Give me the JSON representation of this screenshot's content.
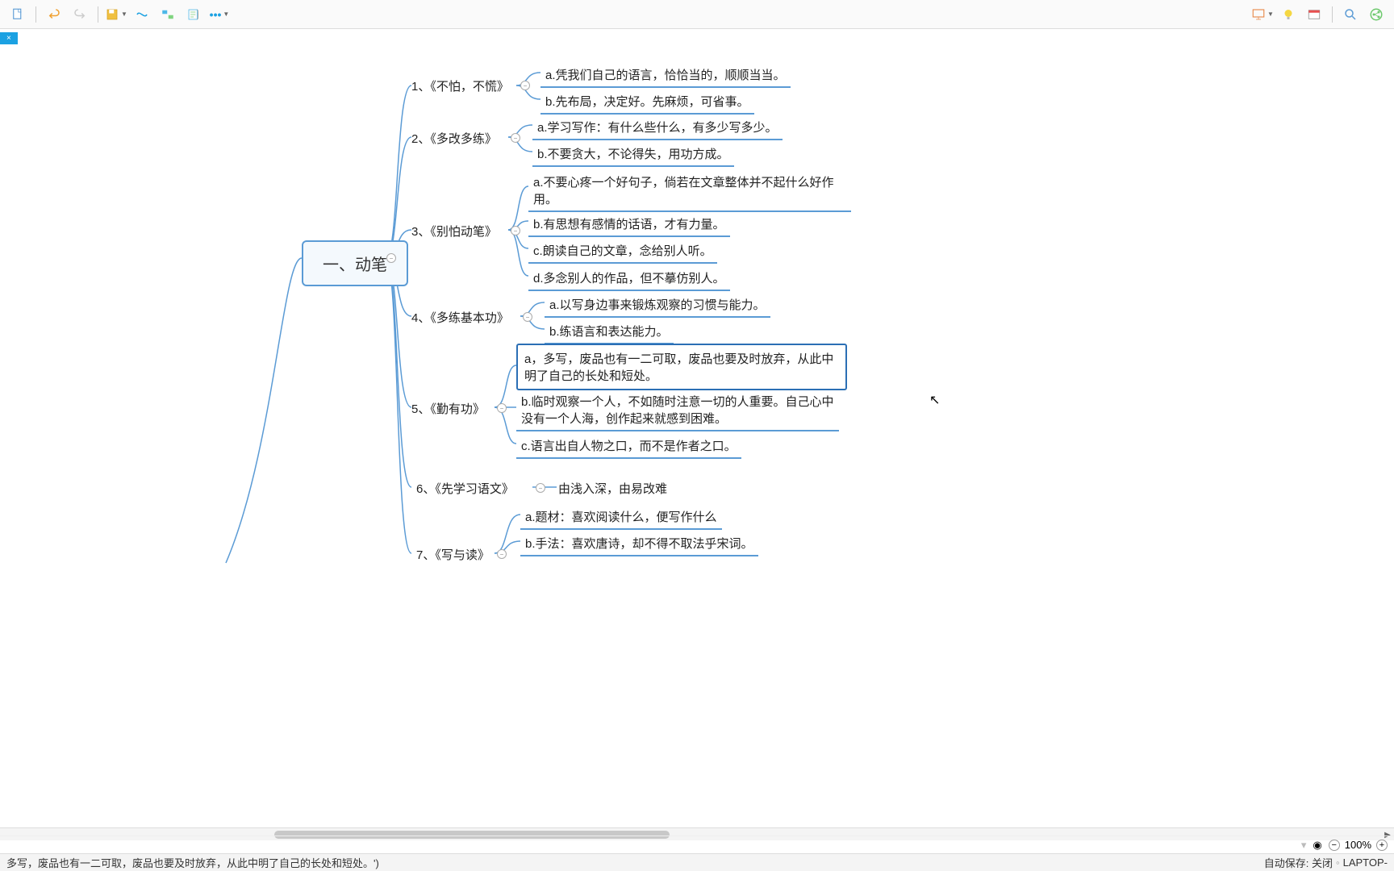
{
  "toolbar": {
    "items": [
      "new",
      "undo",
      "redo",
      "save",
      "relationship",
      "boundary",
      "summary",
      "more"
    ]
  },
  "toolbar_right": {
    "items": [
      "present",
      "idea",
      "theme",
      "search",
      "share"
    ]
  },
  "tab": {
    "close": "×"
  },
  "root": "一、动笔",
  "branches": [
    {
      "label": "1、《不怕，不慌》",
      "leaves": [
        "a.凭我们自己的语言，恰恰当的，顺顺当当。",
        "b.先布局，决定好。先麻烦，可省事。"
      ]
    },
    {
      "label": "2、《多改多练》",
      "leaves": [
        "a.学习写作：有什么些什么，有多少写多少。",
        "b.不要贪大，不论得失，用功方成。"
      ]
    },
    {
      "label": "3、《别怕动笔》",
      "leaves": [
        "a.不要心疼一个好句子，倘若在文章整体并不起什么好作用。",
        "b.有思想有感情的话语，才有力量。",
        "c.朗读自己的文章，念给别人听。",
        "d.多念别人的作品，但不摹仿别人。"
      ]
    },
    {
      "label": "4、《多练基本功》",
      "leaves": [
        "a.以写身边事来锻炼观察的习惯与能力。",
        "b.练语言和表达能力。"
      ]
    },
    {
      "label": "5、《勤有功》",
      "leaves": [
        "a，多写，废品也有一二可取，废品也要及时放弃，从此中明了自己的长处和短处。",
        "b.临时观察一个人，不如随时注意一切的人重要。自己心中没有一个人海，创作起来就感到困难。",
        "c.语言出自人物之口，而不是作者之口。"
      ]
    },
    {
      "label": "6、《先学习语文》",
      "leaves": [
        "由浅入深，由易改难"
      ]
    },
    {
      "label": "7、《写与读》",
      "leaves": [
        "a.题材：喜欢阅读什么，便写作什么",
        "b.手法：喜欢唐诗，却不得不取法乎宋词。"
      ]
    }
  ],
  "zoom": "100%",
  "status_left": "多写，废品也有一二可取，废品也要及时放弃，从此中明了自己的长处和短处。')",
  "status_right_autosave": "自动保存: 关闭",
  "status_right_host": "LAPTOP-"
}
